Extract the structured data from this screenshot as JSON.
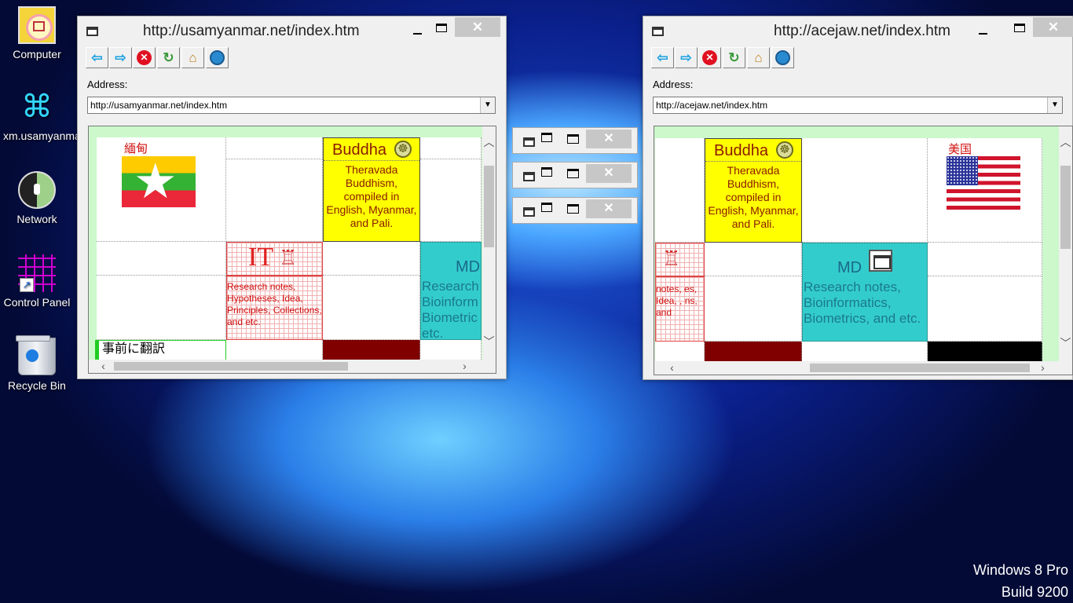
{
  "desktop": {
    "icons": [
      {
        "label": "Computer",
        "icon": "computer-icon"
      },
      {
        "label": "xm.usamyanmar.net",
        "icon": "robot-icon"
      },
      {
        "label": "Network",
        "icon": "network-icon"
      },
      {
        "label": "Control Panel",
        "icon": "control-panel-icon"
      },
      {
        "label": "Recycle Bin",
        "icon": "recycle-bin-icon"
      }
    ],
    "watermark": {
      "line1": "Windows 8 Pro",
      "line2": "Build 9200"
    }
  },
  "window_left": {
    "title": "http://usamyanmar.net/index.htm",
    "address_label": "Address:",
    "address_value": "http://usamyanmar.net/index.htm",
    "close_glyph": "✕",
    "page": {
      "flag_label": "緬甸",
      "buddha_title": "Buddha",
      "buddha_text": "Theravada Buddhism, compiled in English, Myanmar, and Pali.",
      "it_title": "IT",
      "it_text": "Research notes, Hypotheses, Idea, Principles, Collections, and etc.",
      "md_title": "MD",
      "md_text": "Research Bioinform Biometric etc.",
      "translate_button": "事前に翻訳"
    }
  },
  "window_right": {
    "title": "http://acejaw.net/index.htm",
    "address_label": "Address:",
    "address_value": "http://acejaw.net/index.htm",
    "close_glyph": "✕",
    "page": {
      "flag_label": "美国",
      "buddha_title": "Buddha",
      "buddha_text": "Theravada Buddhism, compiled in English, Myanmar, and Pali.",
      "it_text": "notes, es, Idea, , ns, and",
      "md_title": "MD",
      "md_text": "Research notes, Bioinformatics, Biometrics, and etc."
    }
  },
  "minimized_windows": [
    {
      "close_glyph": "✕"
    },
    {
      "close_glyph": "✕"
    },
    {
      "close_glyph": "✕"
    }
  ],
  "toolbar_icons": [
    "back-icon",
    "forward-icon",
    "stop-icon",
    "refresh-icon",
    "home-icon",
    "search-icon"
  ],
  "colors": {
    "buddha_bg": "#ffff00",
    "md_bg": "#33cccc",
    "content_bg": "#ccf8cc",
    "it_red": "#e02020"
  }
}
